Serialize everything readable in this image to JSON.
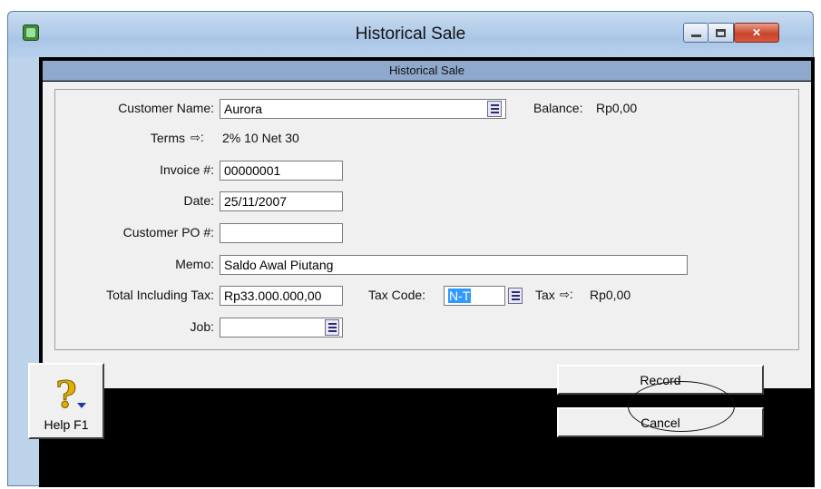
{
  "window": {
    "title": "Historical Sale"
  },
  "header": {
    "title": "Historical Sale"
  },
  "form": {
    "customer_name_label": "Customer Name:",
    "customer_name_value": "Aurora",
    "balance_label": "Balance:",
    "balance_value": "Rp0,00",
    "terms_label": "Terms",
    "terms_value": "2% 10 Net 30",
    "invoice_label": "Invoice #:",
    "invoice_value": "00000001",
    "date_label": "Date:",
    "date_value": "25/11/2007",
    "customer_po_label": "Customer PO #:",
    "customer_po_value": "",
    "memo_label": "Memo:",
    "memo_value": "Saldo Awal Piutang",
    "total_label": "Total Including Tax:",
    "total_value": "Rp33.000.000,00",
    "tax_code_label": "Tax Code:",
    "tax_code_value": "N-T",
    "tax_label": "Tax",
    "tax_value": "Rp0,00",
    "job_label": "Job:",
    "job_value": ""
  },
  "buttons": {
    "help_label": "Help F1",
    "record_label": "Record",
    "cancel_label": "Cancel"
  },
  "icons": {
    "app": "app-icon",
    "minimize": "minimize-icon",
    "maximize": "maximize-icon",
    "close": "close-icon",
    "dropdown": "list-icon",
    "arrow": "arrow-right-icon",
    "help": "question-mark-icon"
  }
}
